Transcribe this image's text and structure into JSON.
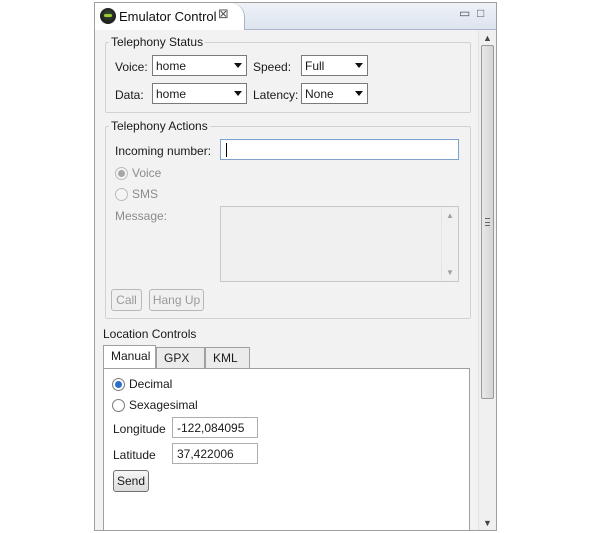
{
  "window": {
    "tab_title": "Emulator Control",
    "tab_icon": "android-emulator-icon",
    "close_glyph": "⊠",
    "minimize_glyph": "▭",
    "maximize_glyph": "□"
  },
  "telephony_status": {
    "legend": "Telephony Status",
    "voice_label": "Voice:",
    "voice_value": "home",
    "speed_label": "Speed:",
    "speed_value": "Full",
    "data_label": "Data:",
    "data_value": "home",
    "latency_label": "Latency:",
    "latency_value": "None"
  },
  "telephony_actions": {
    "legend": "Telephony Actions",
    "incoming_label": "Incoming number:",
    "incoming_value": "",
    "voice_option": "Voice",
    "sms_option": "SMS",
    "message_label": "Message:",
    "message_value": "",
    "call_button": "Call",
    "hangup_button": "Hang Up"
  },
  "location_controls": {
    "title": "Location Controls",
    "tabs": [
      {
        "label": "Manual",
        "active": true
      },
      {
        "label": "GPX",
        "active": false
      },
      {
        "label": "KML",
        "active": false
      }
    ],
    "decimal_option": "Decimal",
    "sexagesimal_option": "Sexagesimal",
    "selected_format": "Decimal",
    "longitude_label": "Longitude",
    "longitude_value": "-122,084095",
    "latitude_label": "Latitude",
    "latitude_value": "37,422006",
    "send_button": "Send"
  },
  "colors": {
    "radio_selected": "#2a6fc9",
    "tab_border": "#a9b6c8"
  }
}
